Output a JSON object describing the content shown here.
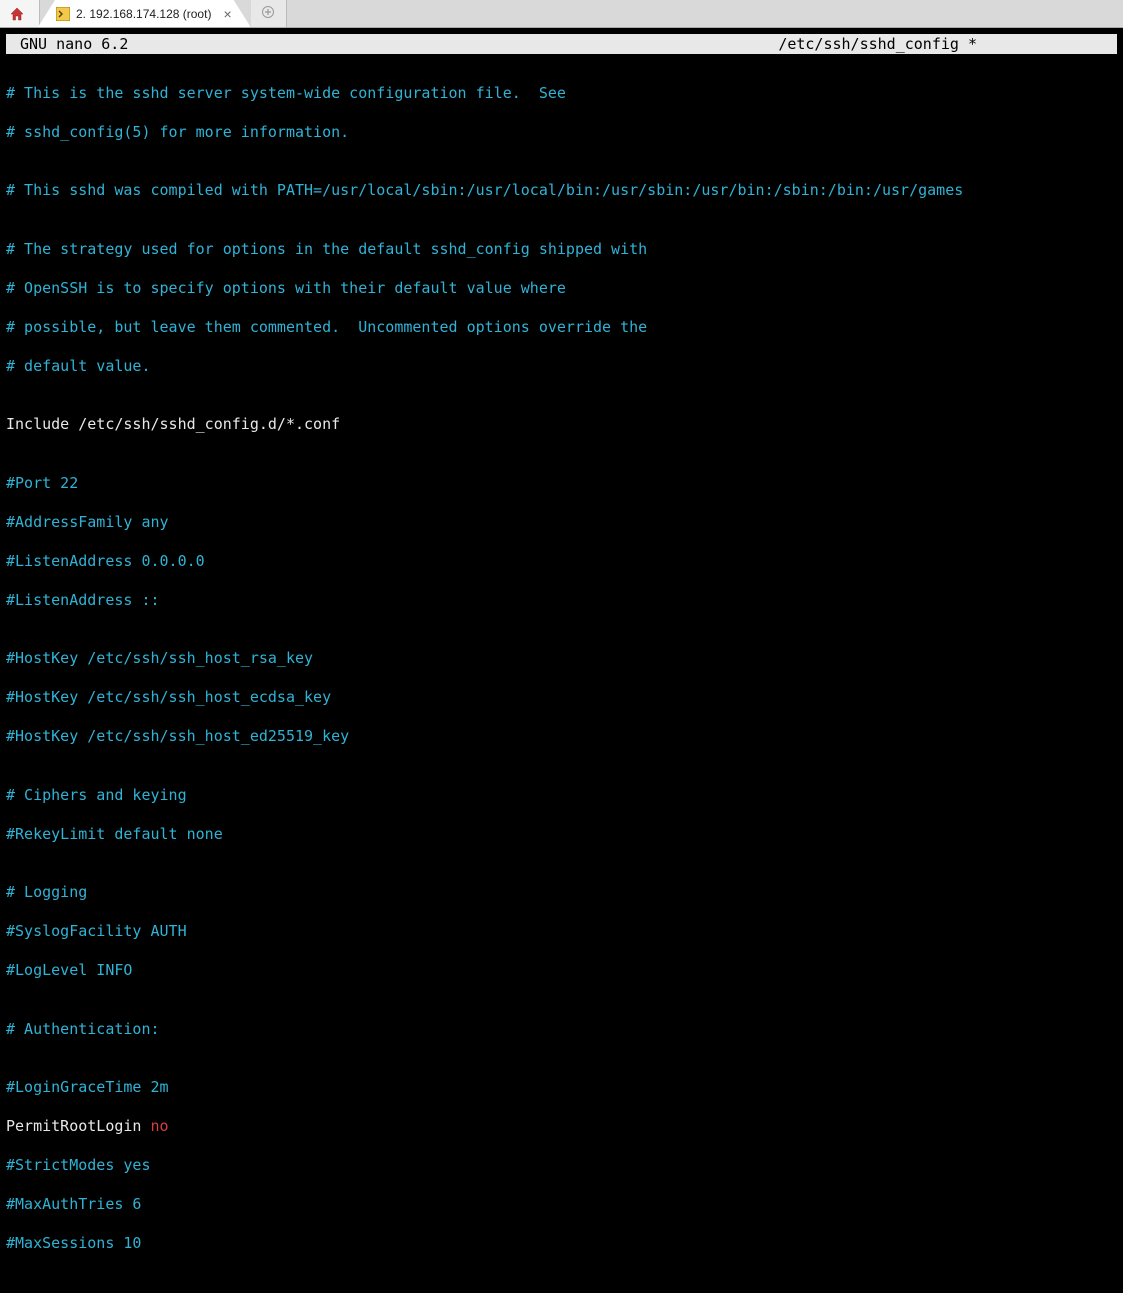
{
  "tabs": {
    "home_title": "Home",
    "session_title": "2. 192.168.174.128 (root)",
    "new_title": "New tab"
  },
  "nano": {
    "app": "GNU nano 6.2",
    "file": "/etc/ssh/sshd_config *"
  },
  "config": {
    "l01": "# This is the sshd server system-wide configuration file.  See",
    "l02": "# sshd_config(5) for more information.",
    "l03": "",
    "l04": "# This sshd was compiled with PATH=/usr/local/sbin:/usr/local/bin:/usr/sbin:/usr/bin:/sbin:/bin:/usr/games",
    "l05": "",
    "l06": "# The strategy used for options in the default sshd_config shipped with",
    "l07": "# OpenSSH is to specify options with their default value where",
    "l08": "# possible, but leave them commented.  Uncommented options override the",
    "l09": "# default value.",
    "l10": "",
    "l11": "Include /etc/ssh/sshd_config.d/*.conf",
    "l12": "",
    "l13": "#Port 22",
    "l14": "#AddressFamily any",
    "l15": "#ListenAddress 0.0.0.0",
    "l16": "#ListenAddress ::",
    "l17": "",
    "l18": "#HostKey /etc/ssh/ssh_host_rsa_key",
    "l19": "#HostKey /etc/ssh/ssh_host_ecdsa_key",
    "l20": "#HostKey /etc/ssh/ssh_host_ed25519_key",
    "l21": "",
    "l22": "# Ciphers and keying",
    "l23": "#RekeyLimit default none",
    "l24": "",
    "l25": "# Logging",
    "l26": "#SyslogFacility AUTH",
    "l27": "#LogLevel INFO",
    "l28": "",
    "l29": "# Authentication:",
    "l30": "",
    "l31": "#LoginGraceTime 2m",
    "l32k": "PermitRootLogin ",
    "l32v": "no",
    "l33": "#StrictModes yes",
    "l34": "#MaxAuthTries 6",
    "l35": "#MaxSessions 10"
  }
}
